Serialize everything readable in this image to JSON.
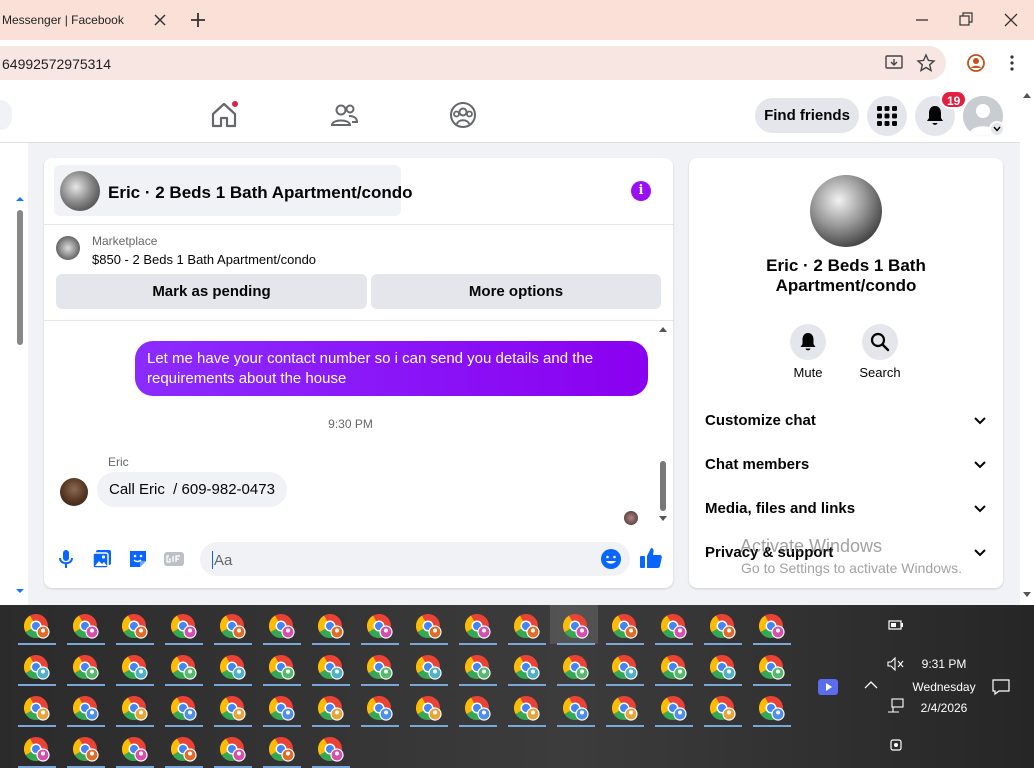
{
  "browser": {
    "tab_title": "Messenger | Facebook",
    "url": "64992572975314"
  },
  "header": {
    "find_friends": "Find friends",
    "notification_count": "19"
  },
  "chat": {
    "title": "Eric · 2 Beds 1 Bath Apartment/condo",
    "marketplace_label": "Marketplace",
    "listing": "$850 - 2 Beds 1 Bath Apartment/condo",
    "mark_pending": "Mark as pending",
    "more_options": "More options",
    "messages": {
      "outgoing": "Let me have your contact number so i can send you details and the requirements about the house",
      "timestamp": "9:30 PM",
      "sender": "Eric",
      "incoming": "Call Eric  / 609-982-0473"
    },
    "composer_placeholder": "Aa",
    "info_glyph": "i"
  },
  "details": {
    "title": "Eric · 2 Beds 1 Bath Apartment/condo",
    "mute": "Mute",
    "search": "Search",
    "rows": [
      "Customize chat",
      "Chat members",
      "Media, files and links",
      "Privacy & support"
    ]
  },
  "watermark": {
    "line1": "Activate Windows",
    "line2": "Go to Settings to activate Windows."
  },
  "tray": {
    "time": "9:31 PM",
    "day": "Wednesday",
    "date": "2/4/2026"
  },
  "colors": {
    "accent": "#0866ff",
    "outgoing_bubble": "#8a00f0",
    "badge": "#e41e3f"
  }
}
